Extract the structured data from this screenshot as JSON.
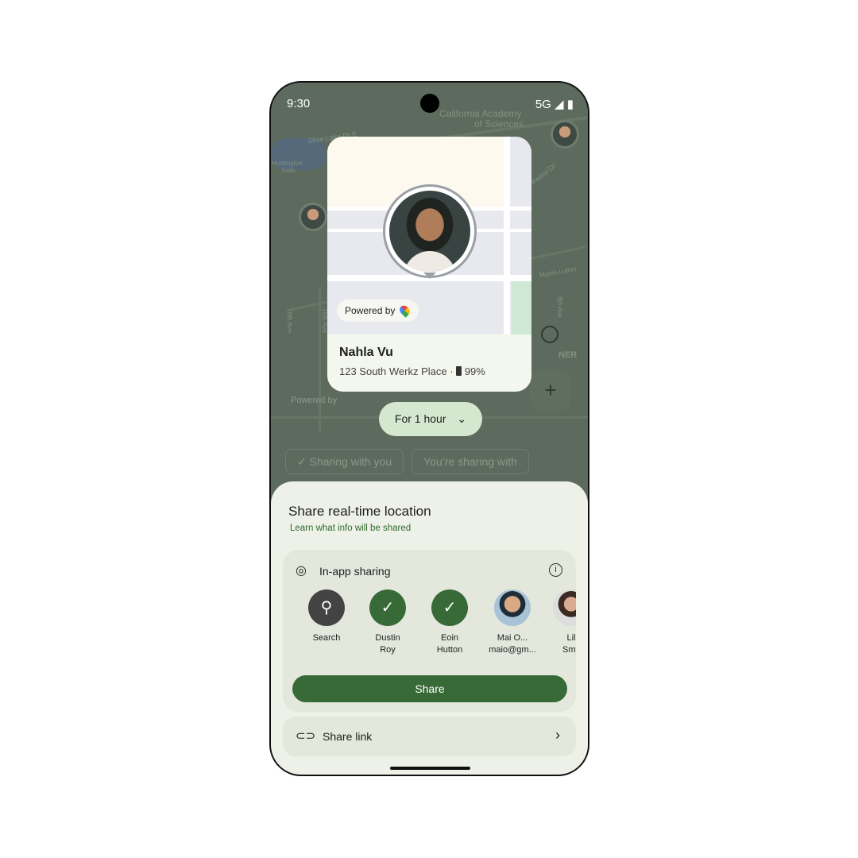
{
  "status": {
    "time": "9:30",
    "network": "5G"
  },
  "map": {
    "labels": [
      "California Academy",
      "of Sciences",
      "Stow Lake Dr E",
      "Huntington",
      "Falls",
      "Pelosi Dr",
      "16th Ave",
      "15th Ave",
      "8th Ave",
      "Martin Luther",
      "NER"
    ],
    "powered_by": "Powered by"
  },
  "card": {
    "powered_by": "Powered by",
    "name": "Nahla Vu",
    "address": "123 South Werkz Place ·",
    "battery": "99%"
  },
  "duration": {
    "label": "For 1 hour"
  },
  "tabs": [
    {
      "label": "Sharing with you"
    },
    {
      "label": "You’re sharing with"
    }
  ],
  "sheet": {
    "title": "Share real-time location",
    "learn": "Learn what info will be shared",
    "inapp": {
      "title": "In-app sharing",
      "contacts": [
        {
          "line1": "Search",
          "line2": ""
        },
        {
          "line1": "Dustin",
          "line2": "Roy"
        },
        {
          "line1": "Eoin",
          "line2": "Hutton"
        },
        {
          "line1": "Mai O...",
          "line2": "maio@gm..."
        },
        {
          "line1": "Lil",
          "line2": "Smy"
        }
      ]
    },
    "share_button": "Share",
    "share_link": "Share link"
  },
  "colors": {
    "accent": "#386a38",
    "chip": "#d4e8cf",
    "sheet": "#eef1e7"
  }
}
